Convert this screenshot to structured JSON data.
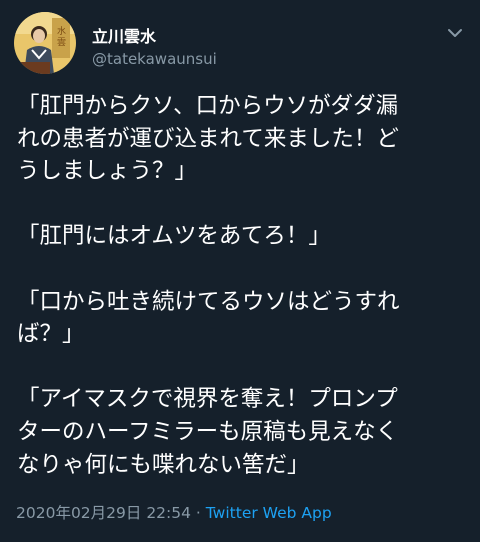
{
  "tweet": {
    "author": {
      "display_name": "立川雲水",
      "handle": "@tatekawaunsui"
    },
    "text_lines": [
      "「肛門からクソ、口からウソがダダ漏",
      "れの患者が運び込まれて来ました！ど",
      "うしましょう？」",
      "",
      "「肛門にはオムツをあてろ！」",
      "",
      "「口から吐き続けてるウソはどうすれ",
      "ば？」",
      "",
      "「アイマスクで視界を奪え！プロンプ",
      "ターのハーフミラーも原稿も見えなく",
      "なりゃ何にも喋れない筈だ」"
    ],
    "timestamp": "2020年02月29日 22:54",
    "separator": " · ",
    "source": "Twitter Web App"
  },
  "icons": {
    "avatar": "avatar-portrait",
    "menu": "chevron-down-icon"
  },
  "colors": {
    "background": "#15202b",
    "text_primary": "#ffffff",
    "text_secondary": "#8899a6",
    "link": "#1da1f2"
  }
}
